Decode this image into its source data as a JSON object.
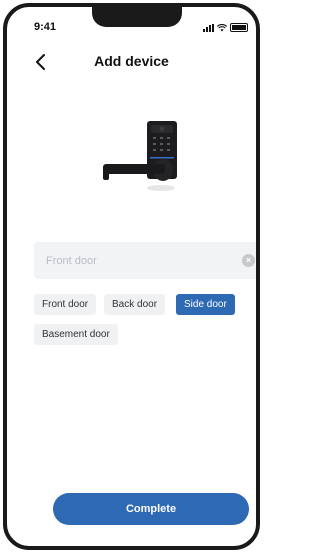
{
  "status_bar": {
    "time": "9:41"
  },
  "header": {
    "title": "Add device"
  },
  "name_field": {
    "placeholder": "Front door",
    "value": ""
  },
  "chips": [
    {
      "label": "Front door",
      "selected": false
    },
    {
      "label": "Back door",
      "selected": false
    },
    {
      "label": "Side door",
      "selected": true
    },
    {
      "label": "Basement door",
      "selected": false
    }
  ],
  "footer": {
    "complete_label": "Complete"
  },
  "colors": {
    "accent": "#2e69b4",
    "chip_bg": "#f0f1f3",
    "field_bg": "#f2f3f5"
  },
  "icons": {
    "back": "chevron-left-icon",
    "clear": "clear-icon",
    "product": "smart-lock-image"
  }
}
